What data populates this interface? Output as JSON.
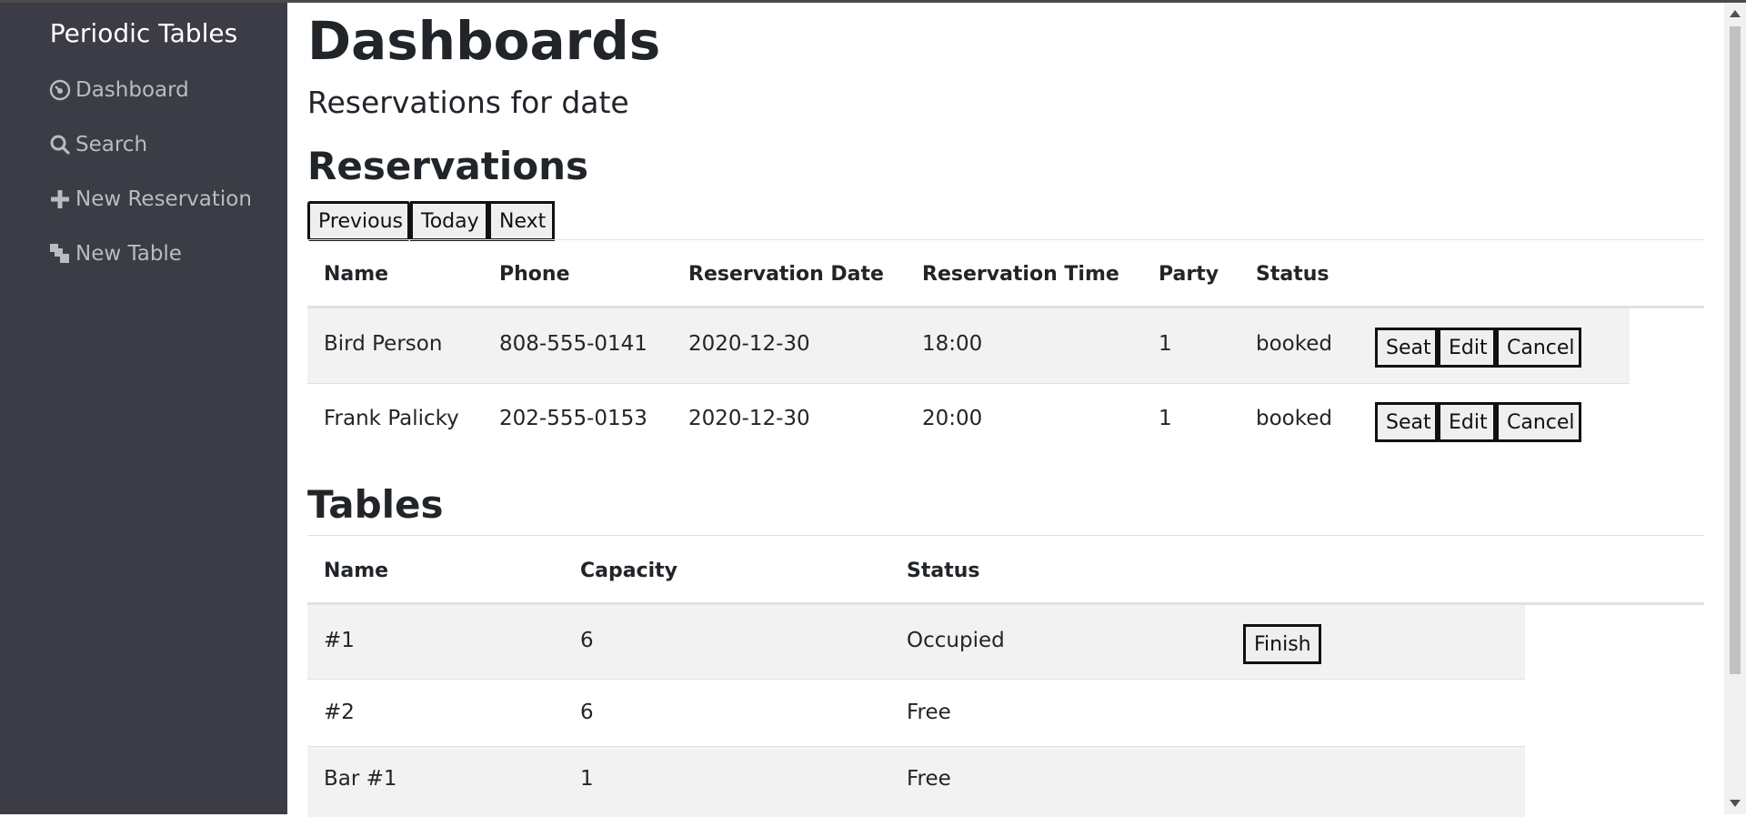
{
  "sidebar": {
    "brand": "Periodic Tables",
    "items": [
      {
        "label": "Dashboard",
        "icon": "dashboard-icon"
      },
      {
        "label": "Search",
        "icon": "search-icon"
      },
      {
        "label": "New Reservation",
        "icon": "plus-icon"
      },
      {
        "label": "New Table",
        "icon": "table-icon"
      }
    ]
  },
  "main": {
    "title": "Dashboards",
    "subtitle": "Reservations for date",
    "reservations_title": "Reservations",
    "date_nav": {
      "previous": "Previous",
      "today": "Today",
      "next": "Next"
    },
    "reservations": {
      "headers": [
        "Name",
        "Phone",
        "Reservation Date",
        "Reservation Time",
        "Party",
        "Status"
      ],
      "rows": [
        {
          "name": "Bird Person",
          "phone": "808-555-0141",
          "date": "2020-12-30",
          "time": "18:00",
          "party": "1",
          "status": "booked",
          "actions": [
            "Seat",
            "Edit",
            "Cancel"
          ]
        },
        {
          "name": "Frank Palicky",
          "phone": "202-555-0153",
          "date": "2020-12-30",
          "time": "20:00",
          "party": "1",
          "status": "booked",
          "actions": [
            "Seat",
            "Edit",
            "Cancel"
          ]
        }
      ]
    },
    "tables_title": "Tables",
    "tables": {
      "headers": [
        "Name",
        "Capacity",
        "Status"
      ],
      "rows": [
        {
          "name": "#1",
          "capacity": "6",
          "status": "Occupied",
          "action": "Finish"
        },
        {
          "name": "#2",
          "capacity": "6",
          "status": "Free"
        },
        {
          "name": "Bar #1",
          "capacity": "1",
          "status": "Free"
        }
      ]
    }
  },
  "colors": {
    "sidebar_bg": "#3b3c45",
    "sidebar_text": "#b9bcc2",
    "stripe": "#f2f2f2"
  }
}
